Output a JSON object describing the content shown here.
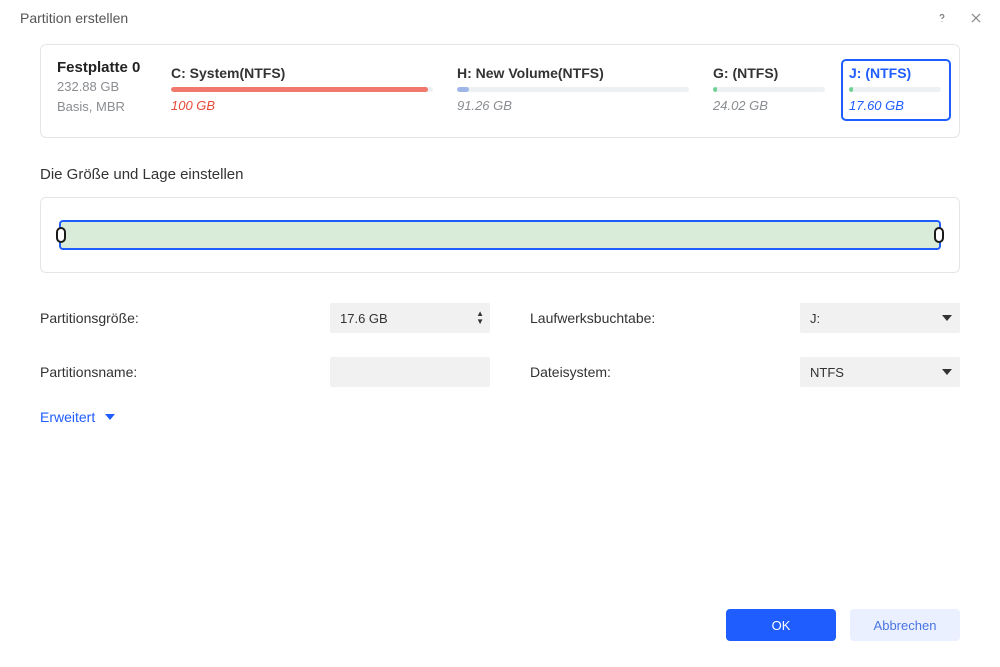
{
  "window": {
    "title": "Partition erstellen"
  },
  "disk": {
    "name": "Festplatte 0",
    "size": "232.88 GB",
    "type": "Basis, MBR"
  },
  "partitions": [
    {
      "label": "C: System(NTFS)",
      "size": "100 GB",
      "bar_fill_pct": 98,
      "bar_color": "#f0786d",
      "size_class": "red",
      "selected": false,
      "flex": 280
    },
    {
      "label": "H: New Volume(NTFS)",
      "size": "91.26 GB",
      "bar_fill_pct": 5,
      "bar_color": "#9fb6e8",
      "size_class": "",
      "selected": false,
      "flex": 250
    },
    {
      "label": "G: (NTFS)",
      "size": "24.02 GB",
      "bar_fill_pct": 4,
      "bar_color": "#6fd18f",
      "size_class": "",
      "selected": false,
      "flex": 130
    },
    {
      "label": "J: (NTFS)",
      "size": "17.60 GB",
      "bar_fill_pct": 4,
      "bar_color": "#6fd18f",
      "size_class": "blue",
      "selected": true,
      "flex": 110
    }
  ],
  "section": {
    "size_pos_title": "Die Größe und Lage einstellen"
  },
  "form": {
    "partition_size_label": "Partitionsgröße:",
    "partition_size_value": "17.6 GB",
    "partition_name_label": "Partitionsname:",
    "partition_name_value": "",
    "drive_letter_label": "Laufwerksbuchtabe:",
    "drive_letter_value": "J:",
    "filesystem_label": "Dateisystem:",
    "filesystem_value": "NTFS",
    "advanced_label": "Erweitert"
  },
  "buttons": {
    "ok": "OK",
    "cancel": "Abbrechen"
  }
}
